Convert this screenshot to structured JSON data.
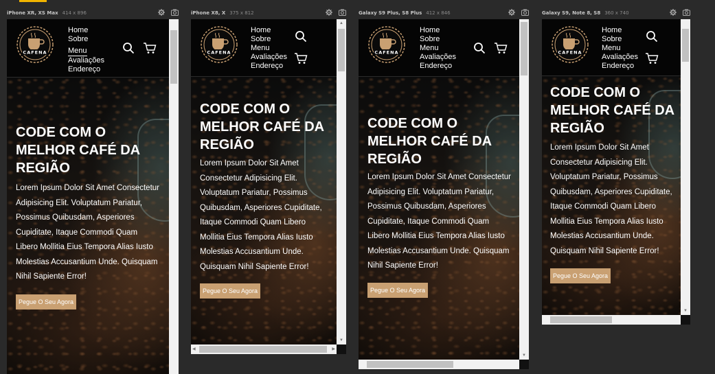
{
  "devices": [
    {
      "name": "iPhone XR, XS Max",
      "dims": "414 x 896"
    },
    {
      "name": "iPhone X8, X",
      "dims": "375 x 812"
    },
    {
      "name": "Galaxy S9 Plus, S8 Plus",
      "dims": "412 x 846"
    },
    {
      "name": "Galaxy S9, Note 8, S8",
      "dims": "360 x 740"
    }
  ],
  "site": {
    "logo_text": "CAFENA",
    "nav": [
      "Home",
      "Sobre",
      "Menu",
      "Avaliações",
      "Endereço"
    ],
    "hero_title": "CODE COM O MELHOR CAFÉ DA REGIÃO",
    "hero_text": "Lorem Ipsum Dolor Sit Amet Consectetur Adipisicing Elit. Voluptatum Pariatur, Possimus Quibusdam, Asperiores Cupiditate, Itaque Commodi Quam Libero Mollitia Eius Tempora Alias Iusto Molestias Accusantium Unde. Quisquam Nihil Sapiente Error!",
    "cta": "Pegue O Seu Agora"
  },
  "icons": {
    "gear": "gear-icon",
    "camera": "camera-icon",
    "search": "search-icon",
    "cart": "cart-icon"
  },
  "colors": {
    "accent": "#c9a072",
    "nav_bg": "#050505",
    "tab_indicator": "#f0b400"
  }
}
